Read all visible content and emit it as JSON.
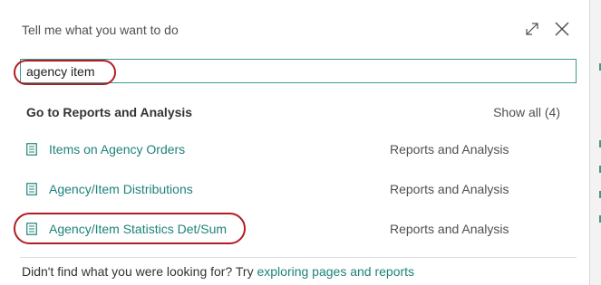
{
  "dialog": {
    "title": "Tell me what you want to do",
    "expand_icon": "expand-diagonal-icon",
    "close_icon": "close-x-icon"
  },
  "search": {
    "value": "agency item",
    "placeholder": ""
  },
  "section": {
    "heading": "Go to Reports and Analysis",
    "show_all": "Show all (4)"
  },
  "results": [
    {
      "label": "Items on Agency Orders",
      "category": "Reports and Analysis",
      "icon": "report-document-icon"
    },
    {
      "label": "Agency/Item Distributions",
      "category": "Reports and Analysis",
      "icon": "report-document-icon"
    },
    {
      "label": "Agency/Item Statistics Det/Sum",
      "category": "Reports and Analysis",
      "icon": "report-document-icon"
    }
  ],
  "footer": {
    "text": "Didn't find what you were looking for? Try ",
    "link": "exploring pages and reports"
  },
  "colors": {
    "accent": "#1d8379",
    "highlight_oval": "#b01e24",
    "text": "#333333",
    "muted_text": "#505050"
  }
}
